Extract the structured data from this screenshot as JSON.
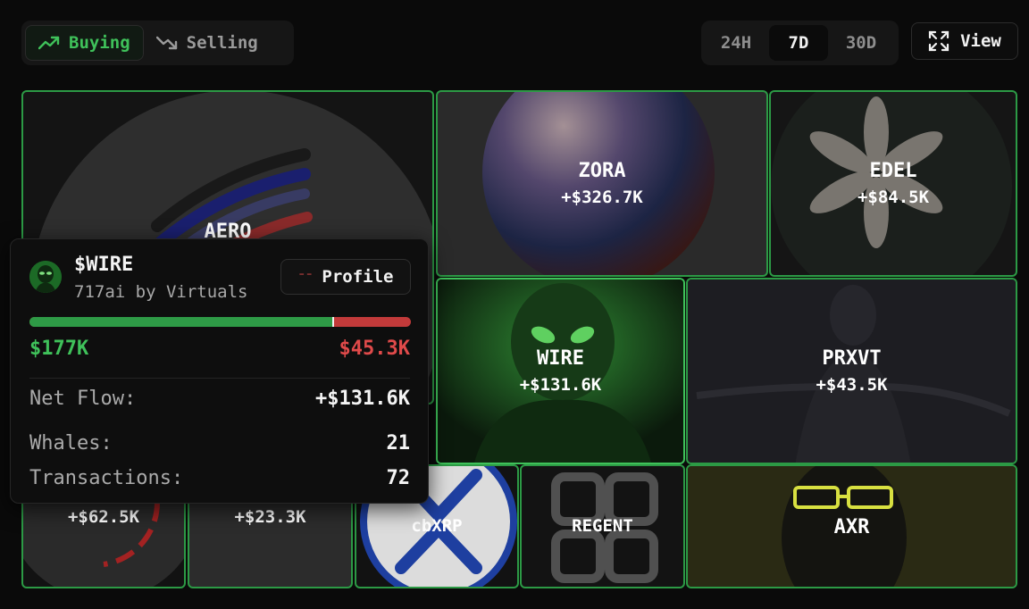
{
  "filters": {
    "buying_label": "Buying",
    "selling_label": "Selling",
    "buying_icon": "trending-up-icon",
    "selling_icon": "trending-down-icon"
  },
  "timeframes": {
    "options": [
      "24H",
      "7D",
      "30D"
    ],
    "selected": "7D"
  },
  "view_button": {
    "label": "View",
    "icon": "expand-icon"
  },
  "tiles": [
    {
      "symbol": "AERO",
      "value": ""
    },
    {
      "symbol": "ZORA",
      "value": "+$326.7K"
    },
    {
      "symbol": "EDEL",
      "value": "+$84.5K"
    },
    {
      "symbol": "WIRE",
      "value": "+$131.6K"
    },
    {
      "symbol": "PRXVT",
      "value": "+$43.5K"
    },
    {
      "symbol": "",
      "value": "+$62.5K"
    },
    {
      "symbol": "",
      "value": "+$23.3K"
    },
    {
      "symbol": "cbXRP",
      "value": ""
    },
    {
      "symbol": "REGENT",
      "value": ""
    },
    {
      "symbol": "AXR",
      "value": ""
    }
  ],
  "tooltip": {
    "ticker": "$WIRE",
    "name": "717ai by Virtuals",
    "profile_label": "Profile",
    "buy_amount": "$177K",
    "sell_amount": "$45.3K",
    "buy_fraction": 0.796,
    "net_flow_label": "Net Flow:",
    "net_flow_value": "+$131.6K",
    "whales_label": "Whales:",
    "whales_value": "21",
    "transactions_label": "Transactions:",
    "transactions_value": "72"
  },
  "colors": {
    "accent_green": "#3fc15a",
    "sell_red": "#e04a4a",
    "tile_border": "#2c9a45"
  }
}
